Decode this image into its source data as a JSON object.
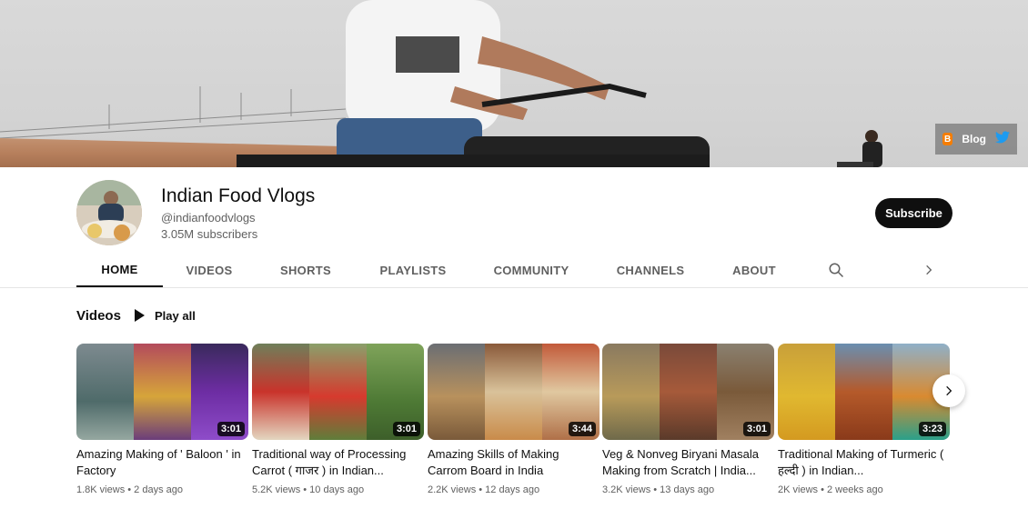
{
  "banner": {
    "blog_label": "Blog",
    "links": [
      "blogger-icon",
      "twitter-icon"
    ]
  },
  "channel": {
    "name": "Indian Food Vlogs",
    "handle": "@indianfoodvlogs",
    "subscribers": "3.05M subscribers",
    "subscribe_label": "Subscribe"
  },
  "tabs": [
    {
      "label": "HOME",
      "active": true
    },
    {
      "label": "VIDEOS"
    },
    {
      "label": "SHORTS"
    },
    {
      "label": "PLAYLISTS"
    },
    {
      "label": "COMMUNITY"
    },
    {
      "label": "CHANNELS"
    },
    {
      "label": "ABOUT"
    }
  ],
  "section": {
    "title": "Videos",
    "play_all": "Play all"
  },
  "videos": [
    {
      "title": "Amazing Making of ' Baloon ' in Factory",
      "duration": "3:01",
      "views": "1.8K views",
      "age": "2 days ago"
    },
    {
      "title": "Traditional way of Processing Carrot ( गाजर ) in Indian...",
      "duration": "3:01",
      "views": "5.2K views",
      "age": "10 days ago"
    },
    {
      "title": "Amazing Skills of Making Carrom Board in India",
      "duration": "3:44",
      "views": "2.2K views",
      "age": "12 days ago"
    },
    {
      "title": "Veg & Nonveg Biryani Masala Making from Scratch | India...",
      "duration": "3:01",
      "views": "3.2K views",
      "age": "13 days ago"
    },
    {
      "title": "Traditional Making of Turmeric ( हल्दी ) in Indian...",
      "duration": "3:23",
      "views": "2K views",
      "age": "2 weeks ago"
    }
  ],
  "colors": {
    "accent": "#0f0f0f",
    "secondary_text": "#606060",
    "blogger": "#f57d00",
    "twitter": "#1d9bf0"
  }
}
